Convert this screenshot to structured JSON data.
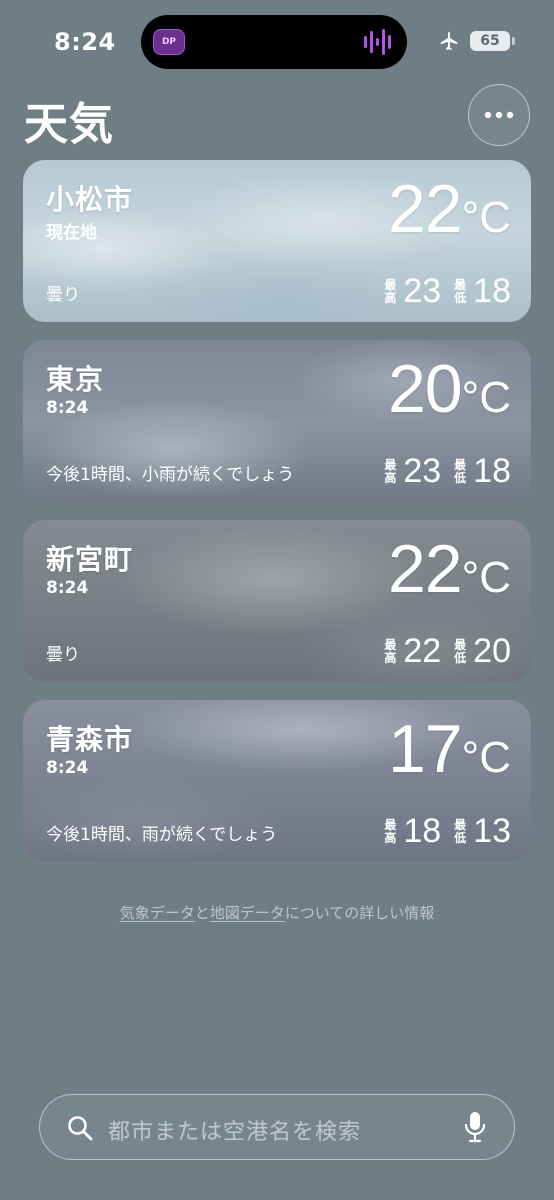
{
  "status_bar": {
    "time": "8:24",
    "battery": "65",
    "island_app_label": "DP"
  },
  "header": {
    "title": "天気"
  },
  "cards": [
    {
      "city": "小松市",
      "subtitle": "現在地",
      "condition": "曇り",
      "temp": "22",
      "unit": "°C",
      "high_label": "最高",
      "high": "23",
      "low_label": "最低",
      "low": "18"
    },
    {
      "city": "東京",
      "subtitle": "8:24",
      "condition": "今後1時間、小雨が続くでしょう",
      "temp": "20",
      "unit": "°C",
      "high_label": "最高",
      "high": "23",
      "low_label": "最低",
      "low": "18"
    },
    {
      "city": "新宮町",
      "subtitle": "8:24",
      "condition": "曇り",
      "temp": "22",
      "unit": "°C",
      "high_label": "最高",
      "high": "22",
      "low_label": "最低",
      "low": "20"
    },
    {
      "city": "青森市",
      "subtitle": "8:24",
      "condition": "今後1時間、雨が続くでしょう",
      "temp": "17",
      "unit": "°C",
      "high_label": "最高",
      "high": "18",
      "low_label": "最低",
      "low": "13"
    }
  ],
  "data_note": {
    "link1": "気象データ",
    "connector": "と",
    "link2": "地図データ",
    "suffix": "についての詳しい情報"
  },
  "search": {
    "placeholder": "都市または空港名を検索"
  },
  "colors": {
    "background": "#6f7e85",
    "search_border": "#c8ebff"
  },
  "icons": {
    "more": "ellipsis-icon",
    "search": "magnifier-icon",
    "mic": "microphone-icon",
    "airplane": "airplane-icon"
  }
}
